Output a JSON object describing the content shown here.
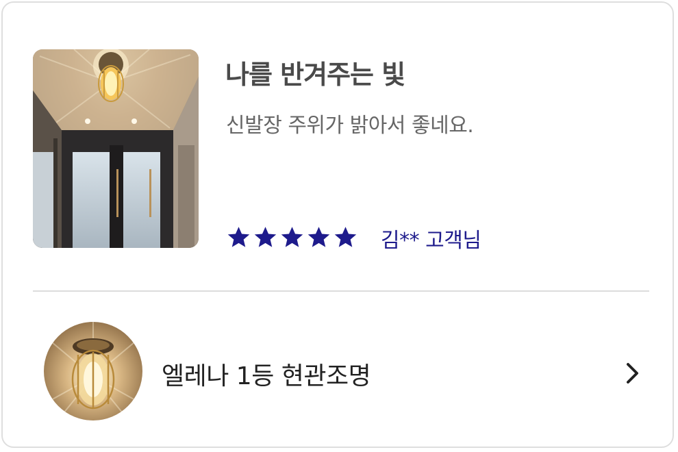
{
  "review": {
    "title": "나를 반겨주는 빛",
    "body": "신발장 주위가 밝아서 좋네요.",
    "rating": 5,
    "max_rating": 5,
    "reviewer": "김** 고객님",
    "star_color": "#1e1b8c"
  },
  "product": {
    "name": "엘레나 1등 현관조명",
    "link_icon": "chevron-right-icon"
  }
}
